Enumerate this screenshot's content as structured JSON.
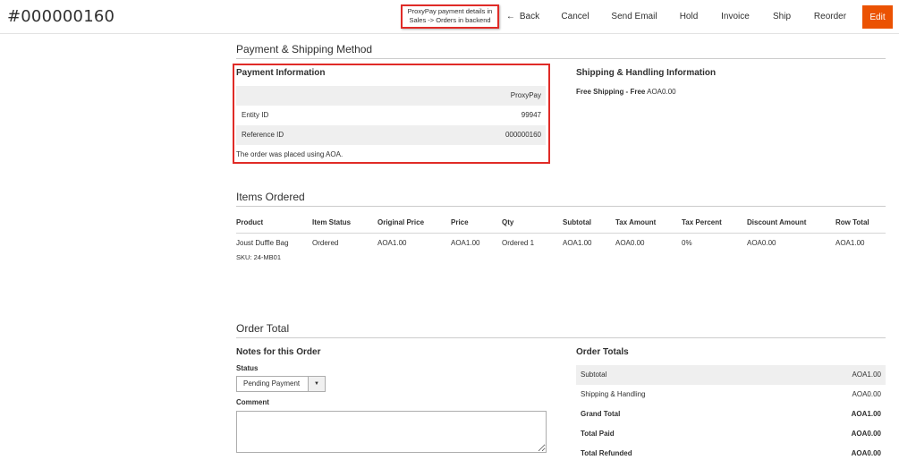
{
  "header": {
    "order_number": "#000000160",
    "callout_line1": "ProxyPay payment details in",
    "callout_line2": "Sales -> Orders in backend",
    "buttons": {
      "back": "Back",
      "cancel": "Cancel",
      "send_email": "Send Email",
      "hold": "Hold",
      "invoice": "Invoice",
      "ship": "Ship",
      "reorder": "Reorder",
      "edit": "Edit"
    },
    "accent_color": "#eb5202",
    "highlight_color": "#e02b27"
  },
  "payment_shipping": {
    "section_title": "Payment & Shipping Method",
    "payment": {
      "title": "Payment Information",
      "method": "ProxyPay",
      "rows": [
        {
          "label": "Entity ID",
          "value": "99947"
        },
        {
          "label": "Reference ID",
          "value": "000000160"
        }
      ],
      "note": "The order was placed using AOA."
    },
    "shipping": {
      "title": "Shipping & Handling Information",
      "method_bold": "Free Shipping - Free",
      "amount": "AOA0.00"
    }
  },
  "items_ordered": {
    "section_title": "Items Ordered",
    "columns": [
      "Product",
      "Item Status",
      "Original Price",
      "Price",
      "Qty",
      "Subtotal",
      "Tax Amount",
      "Tax Percent",
      "Discount Amount",
      "Row Total"
    ],
    "rows": [
      {
        "product": "Joust Duffle Bag",
        "sku": "SKU: 24-MB01",
        "item_status": "Ordered",
        "original_price": "AOA1.00",
        "price": "AOA1.00",
        "qty": "Ordered 1",
        "subtotal": "AOA1.00",
        "tax_amount": "AOA0.00",
        "tax_percent": "0%",
        "discount_amount": "AOA0.00",
        "row_total": "AOA1.00"
      }
    ]
  },
  "order_total": {
    "section_title": "Order Total",
    "notes_title": "Notes for this Order",
    "status_label": "Status",
    "status_value": "Pending Payment",
    "comment_label": "Comment",
    "totals_title": "Order Totals",
    "totals": [
      {
        "label": "Subtotal",
        "value": "AOA1.00",
        "bold": false
      },
      {
        "label": "Shipping & Handling",
        "value": "AOA0.00",
        "bold": false
      },
      {
        "label": "Grand Total",
        "value": "AOA1.00",
        "bold": true
      },
      {
        "label": "Total Paid",
        "value": "AOA0.00",
        "bold": true
      },
      {
        "label": "Total Refunded",
        "value": "AOA0.00",
        "bold": true
      }
    ]
  }
}
